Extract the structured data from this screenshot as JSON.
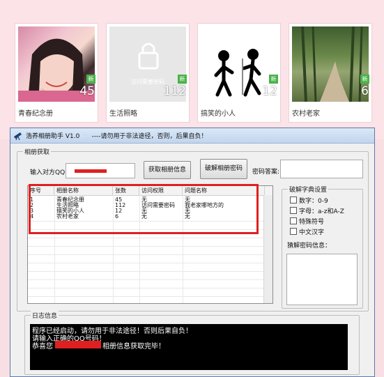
{
  "albums": [
    {
      "name": "青春纪念册",
      "count": "45",
      "badge": "新"
    },
    {
      "name": "生活照略",
      "count": "112",
      "badge": "新",
      "locked_text": "访问需要密码"
    },
    {
      "name": "搞笑的小人",
      "count": "12",
      "badge": "新"
    },
    {
      "name": "农村老家",
      "count": "6",
      "badge": "新"
    }
  ],
  "window": {
    "title": "浩养相册助手 V1.0      ----请勿用于非法途径，否则，后果自负！"
  },
  "fetch_group": {
    "label": "相册获取",
    "qq_label": "输入对方QQ:",
    "get_info_button": "获取相册信息",
    "crack_button": "破解相册密码",
    "answer_label": "密码答案:"
  },
  "table": {
    "headers": [
      "序号",
      "相册名称",
      "张数",
      "访问权限",
      "问题名称"
    ],
    "rows": [
      [
        "1",
        "青春纪念册",
        "45",
        "无",
        "无"
      ],
      [
        "2",
        "生活照略",
        "112",
        "访问需要密码",
        "我老家哪地方的"
      ],
      [
        "3",
        "搞笑的小人",
        "12",
        "无",
        "无"
      ],
      [
        "4",
        "农村老家",
        "6",
        "无",
        "无"
      ]
    ]
  },
  "dict_group": {
    "label": "破解字典设置",
    "options": [
      "数字：0-9",
      "字母：a-z和A-Z",
      "特殊符号",
      "中文汉字"
    ],
    "guess_label": "猜解密码信息："
  },
  "log_group": {
    "label": "日志信息",
    "lines": [
      "程序已经启动，请勿用于非法途径！否则后果自负！",
      "请输入正确的QQ号码！",
      "恭喜您",
      "相册信息获取完毕！"
    ]
  }
}
